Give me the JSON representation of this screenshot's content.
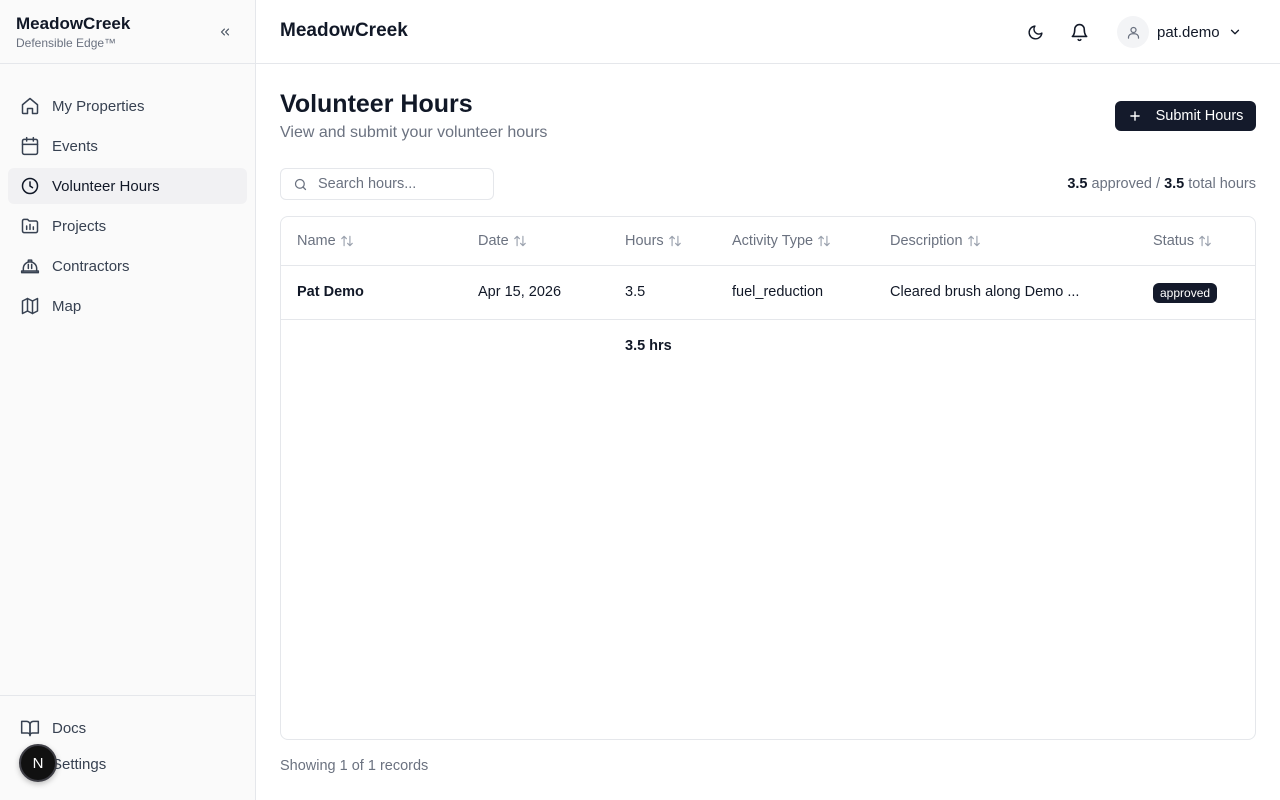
{
  "brand": {
    "name": "MeadowCreek",
    "tagline": "Defensible Edge™"
  },
  "sidebar": {
    "items": [
      {
        "label": "My Properties",
        "icon": "home-icon"
      },
      {
        "label": "Events",
        "icon": "calendar-icon"
      },
      {
        "label": "Volunteer Hours",
        "icon": "clock-icon",
        "active": true
      },
      {
        "label": "Projects",
        "icon": "folder-chart-icon"
      },
      {
        "label": "Contractors",
        "icon": "hard-hat-icon"
      },
      {
        "label": "Map",
        "icon": "map-icon"
      }
    ],
    "bottom": [
      {
        "label": "Docs",
        "icon": "book-icon"
      },
      {
        "label": "Settings",
        "icon": "gear-icon"
      }
    ],
    "fab_label": "N"
  },
  "topbar": {
    "title": "MeadowCreek",
    "username": "pat.demo"
  },
  "page": {
    "title": "Volunteer Hours",
    "subtitle": "View and submit your volunteer hours",
    "submit_label": "Submit Hours",
    "search_placeholder": "Search hours...",
    "totals": {
      "approved": "3.5",
      "approved_label": "approved /",
      "total": "3.5",
      "total_label": "total hours"
    }
  },
  "table": {
    "columns": [
      "Name",
      "Date",
      "Hours",
      "Activity Type",
      "Description",
      "Status"
    ],
    "rows": [
      {
        "name": "Pat Demo",
        "date": "Apr 15, 2026",
        "hours": "3.5",
        "activity": "fuel_reduction",
        "description": "Cleared brush along Demo ...",
        "status": "approved"
      }
    ],
    "footer_total": "3.5 hrs"
  },
  "footer": {
    "records": "Showing 1 of 1 records"
  },
  "colors": {
    "primary": "#141a2b",
    "muted": "#6b7280",
    "border": "#e5e7eb",
    "sidebar_bg": "#fafafa",
    "active_bg": "#f1f1f3"
  }
}
